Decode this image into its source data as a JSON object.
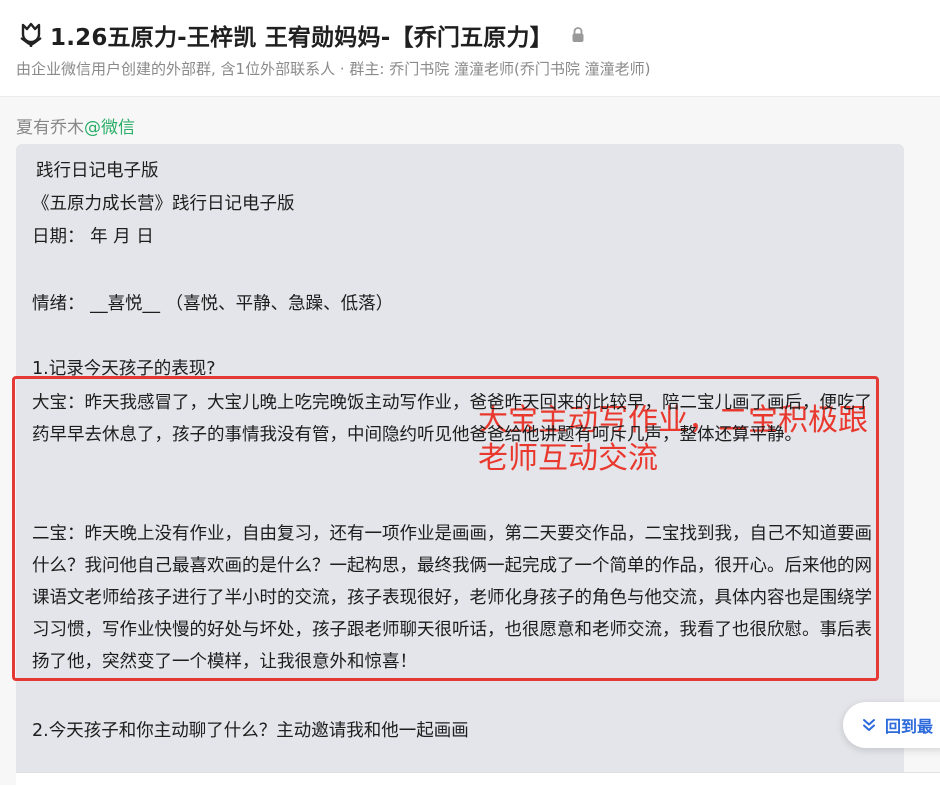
{
  "header": {
    "title": "1.26五原力-王梓凯 王宥勋妈妈-【乔门五原力】",
    "subtitle": "由企业微信用户创建的外部群, 含1位外部联系人 · 群主: 乔门书院 潼潼老师(乔门书院 潼潼老师)",
    "group_icon": "tulip-icon",
    "lock_icon": "lock-icon"
  },
  "message": {
    "sender_name": "夏有乔木",
    "sender_source": "@微信",
    "lines": [
      "践行日记电子版",
      "《五原力成长营》践行日记电子版",
      "日期：    年   月   日",
      "情绪：  __喜悦__  （喜悦、平静、急躁、低落）",
      "1.记录今天孩子的表现?"
    ],
    "para_dabao": "大宝：昨天我感冒了，大宝儿晚上吃完晚饭主动写作业，爸爸昨天回来的比较早，陪二宝儿画了画后，便吃了药早早去休息了，孩子的事情我没有管，中间隐约听见他爸爸给他讲题有呵斥几声，整体还算平静。",
    "para_erbao": "二宝：昨天晚上没有作业，自由复习，还有一项作业是画画，第二天要交作品，二宝找到我，自己不知道要画什么？我问他自己最喜欢画的是什么？一起构思，最终我俩一起完成了一个简单的作品，很开心。后来他的网课语文老师给孩子进行了半小时的交流，孩子表现很好，老师化身孩子的角色与他交流，具体内容也是围绕学习习惯，写作业快慢的好处与坏处，孩子跟老师聊天很听话，也很愿意和老师交流，我看了也很欣慰。事后表扬了他，突然变了一个模样，让我很意外和惊喜！",
    "question2": "2.今天孩子和你主动聊了什么？主动邀请我和他一起画画"
  },
  "annotation": {
    "line1": "大宝主动写作业，二宝积极跟",
    "line2": "老师互动交流",
    "color": "#e9392e"
  },
  "back_button": {
    "label": "回到最",
    "icon": "double-chevron-down-icon"
  }
}
